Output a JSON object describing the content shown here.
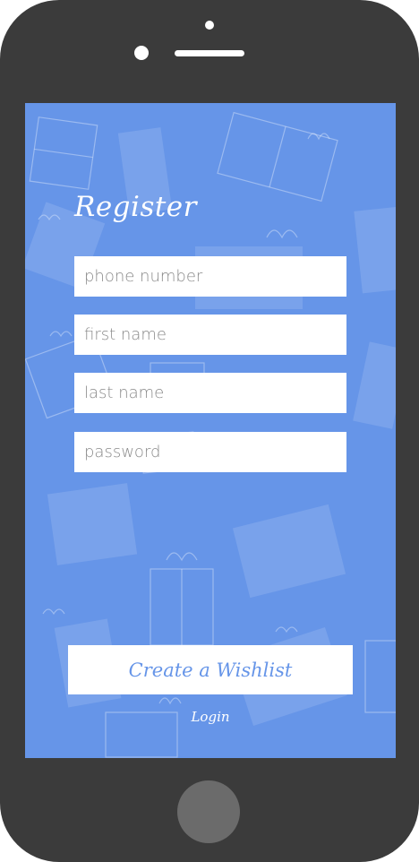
{
  "screen": {
    "title": "Register",
    "fields": {
      "phone_placeholder": "phone number",
      "first_name_placeholder": "first name",
      "last_name_placeholder": "last name",
      "password_placeholder": "password"
    },
    "create_button_label": "Create a Wishlist",
    "login_link_label": "Login"
  },
  "colors": {
    "background": "#6695e8",
    "phone_body": "#3b3b3b",
    "home_button": "#6b6b6b",
    "button_text": "#6695e8"
  },
  "icons": {
    "background_pattern": "gift-box-pattern"
  }
}
